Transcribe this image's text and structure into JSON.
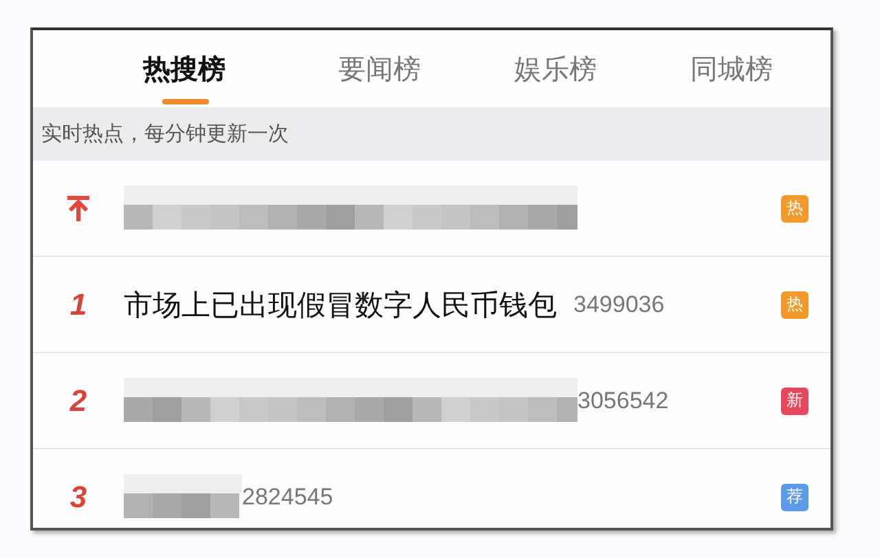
{
  "tabs": [
    {
      "label": "热搜榜",
      "selected": true
    },
    {
      "label": "要闻榜",
      "selected": false
    },
    {
      "label": "娱乐榜",
      "selected": false
    },
    {
      "label": "同城榜",
      "selected": false
    }
  ],
  "subtitle": "实时热点，每分钟更新一次",
  "rows": [
    {
      "kind": "pinned",
      "title_blurred": true,
      "badge": "热",
      "color": "#f39a2b"
    },
    {
      "kind": "ranked",
      "rank": "1",
      "title": "市场上已出现假冒数字人民币钱包",
      "count": "3499036",
      "badge": "热",
      "color": "#f39a2b"
    },
    {
      "kind": "ranked",
      "rank": "2",
      "title_blurred": true,
      "count": "3056542",
      "badge": "新",
      "color": "#e5475c"
    },
    {
      "kind": "ranked",
      "rank": "3",
      "title_blurred": true,
      "count": "2824545",
      "badge": "荐",
      "color": "#5b9ae8"
    }
  ]
}
